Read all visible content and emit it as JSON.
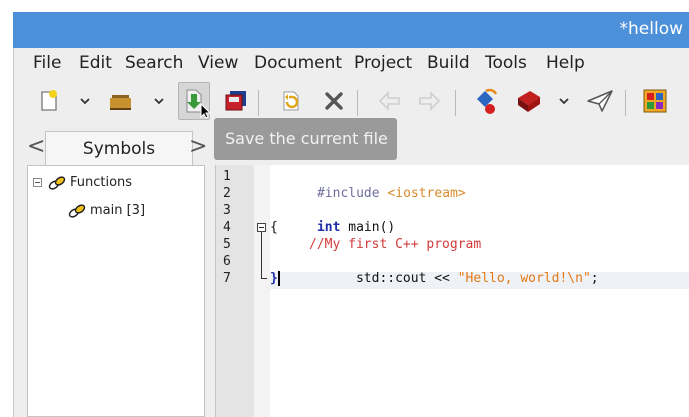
{
  "window": {
    "title": "*hellow"
  },
  "menubar": {
    "items": [
      "File",
      "Edit",
      "Search",
      "View",
      "Document",
      "Project",
      "Build",
      "Tools",
      "Help"
    ]
  },
  "toolbar": {
    "buttons": [
      {
        "icon": "new-file-icon"
      },
      {
        "icon": "open-file-icon"
      },
      {
        "icon": "save-icon"
      },
      {
        "icon": "save-all-icon"
      },
      {
        "icon": "revert-icon"
      },
      {
        "icon": "close-icon"
      },
      {
        "icon": "back-icon"
      },
      {
        "icon": "forward-icon"
      },
      {
        "icon": "compile-icon"
      },
      {
        "icon": "build-icon"
      },
      {
        "icon": "execute-icon"
      },
      {
        "icon": "color-chooser-icon"
      }
    ]
  },
  "tooltip": {
    "text": "Save the current file"
  },
  "sidebar": {
    "tab_label": "Symbols",
    "prev_arrow": "<",
    "next_arrow": ">",
    "tree": [
      {
        "label": "Functions"
      },
      {
        "label": "main [3]"
      }
    ]
  },
  "editor": {
    "line_numbers": [
      "1",
      "2",
      "3",
      "4",
      "5",
      "6",
      "7"
    ],
    "lines": {
      "l1_directive": "#include",
      "l1_header": "<iostream>",
      "l3_keyword": "int",
      "l3_rest": " main()",
      "l4_brace": "{",
      "l5_comment": "//My first C++ program",
      "l6_stmt": "std::cout << ",
      "l6_string": "\"Hello, world!\\n\"",
      "l6_end": ";",
      "l7_brace": "}"
    }
  },
  "colors": {
    "titlebar": "#4d90da",
    "directive": "#6f6f9f",
    "header": "#d98a2b",
    "keyword": "#1f2fa8",
    "comment": "#d23a3a",
    "string": "#e37a16"
  }
}
